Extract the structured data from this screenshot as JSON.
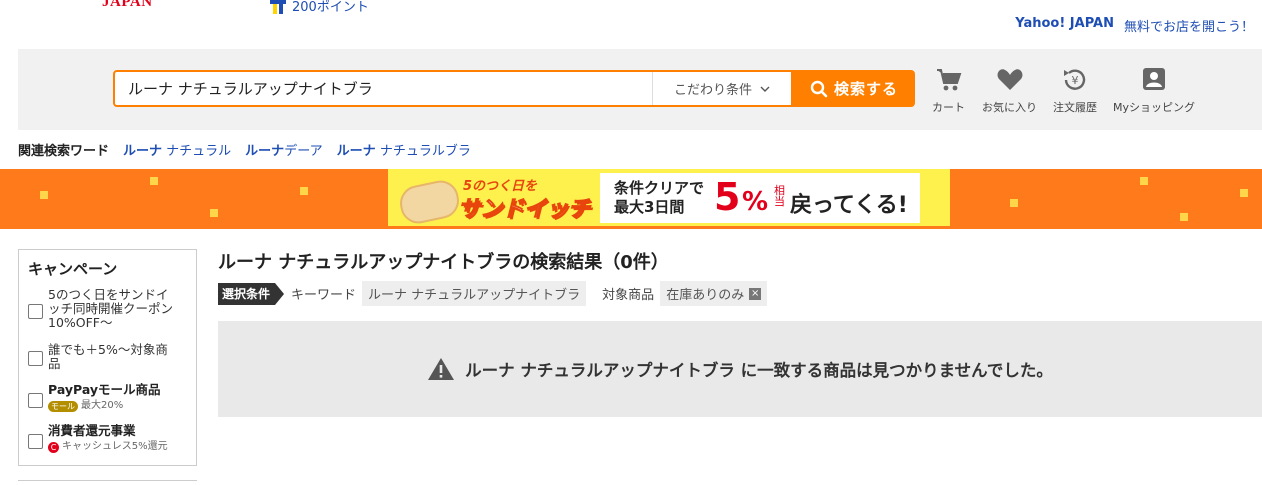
{
  "header": {
    "logo_text": "JAPAN",
    "tpoint_label": "200ポイント",
    "links": [
      {
        "label": "Yahoo! JAPAN"
      },
      {
        "label": "無料でお店を開こう！"
      }
    ]
  },
  "search": {
    "query": "ルーナ ナチュラルアップナイトブラ",
    "options_label": "こだわり条件",
    "button_label": "検索する"
  },
  "nav": [
    {
      "label": "カート",
      "icon": "cart-icon"
    },
    {
      "label": "お気に入り",
      "icon": "heart-icon"
    },
    {
      "label": "注文履歴",
      "icon": "order-history-icon"
    },
    {
      "label": "Myショッピング",
      "icon": "user-icon"
    }
  ],
  "related": {
    "label": "関連検索ワード",
    "words": [
      {
        "strong": "ルーナ",
        "rest": " ナチュラル"
      },
      {
        "strong": "ルーナ",
        "rest": "デーア"
      },
      {
        "strong": "ルーナ",
        "rest": " ナチュラルブラ"
      }
    ]
  },
  "banner": {
    "line1": "5のつく日を",
    "line2": "サンドイッチ",
    "cond1": "条件クリアで",
    "cond2": "最大3日間",
    "big": "5",
    "pct": "%",
    "soutou": "相当",
    "modoru": "戻ってくる!"
  },
  "sidebar": {
    "title": "キャンペーン",
    "items": [
      {
        "label": "5のつく日をサンドイッチ同時開催クーポン　10%OFF〜",
        "sub": ""
      },
      {
        "label": "誰でも＋5%〜対象商品",
        "sub": ""
      },
      {
        "label": "PayPayモール商品",
        "badge": "モール",
        "sub": "最大20%"
      },
      {
        "label": "消費者還元事業",
        "badge": "C",
        "sub": "キャッシュレス5%還元"
      }
    ]
  },
  "results": {
    "title": "ルーナ ナチュラルアップナイトブラの検索結果（0件）",
    "conditions_tag": "選択条件",
    "keyword_label": "キーワード",
    "keyword_value": "ルーナ ナチュラルアップナイトブラ",
    "target_label": "対象商品",
    "target_value": "在庫ありのみ",
    "no_result_message": "ルーナ ナチュラルアップナイトブラ に一致する商品は見つかりませんでした。"
  }
}
